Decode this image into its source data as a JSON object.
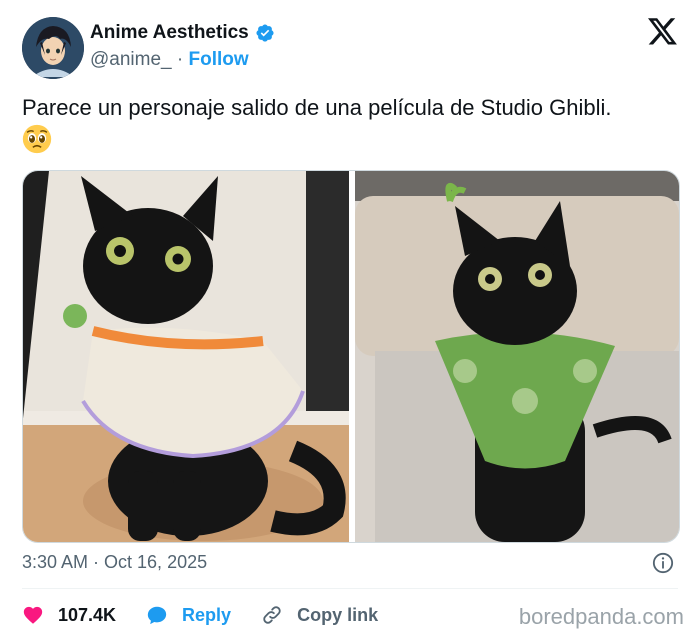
{
  "author": {
    "display_name": "Anime Aesthetics",
    "handle": "@anime_",
    "separator": " · ",
    "follow_label": "Follow",
    "verified": true,
    "avatar_icon": "anime-avatar"
  },
  "platform_icon": "x-logo-icon",
  "post": {
    "text": "Parece un personaje salido de una película de Studio Ghibli.",
    "emoji": "pleading-face-emoji"
  },
  "media": {
    "images": [
      {
        "subject": "black-cat-in-knitted-sweater"
      },
      {
        "subject": "black-cat-in-avocado-bandana"
      }
    ]
  },
  "meta": {
    "timestamp": "3:30 AM · Oct 16, 2025",
    "info_icon": "info-icon"
  },
  "actions": {
    "likes": "107.4K",
    "reply_label": "Reply",
    "copy_label": "Copy link"
  },
  "watermark": "boredpanda.com",
  "colors": {
    "link_blue": "#1d9bf0",
    "like_pink": "#f91880",
    "text_primary": "#0f1419",
    "text_secondary": "#536471"
  }
}
